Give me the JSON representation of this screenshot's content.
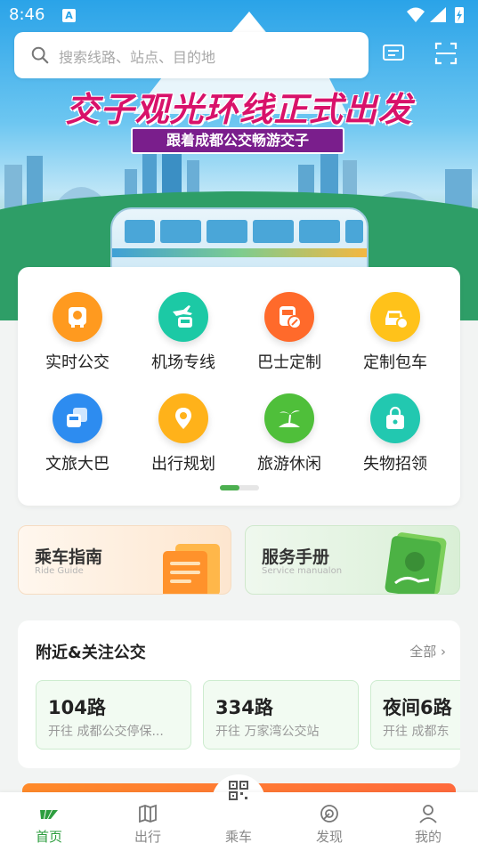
{
  "status_bar": {
    "time": "8:46",
    "notification_icon": "A"
  },
  "search": {
    "placeholder": "搜索线路、站点、目的地"
  },
  "banner": {
    "title": "交子观光环线正式出发",
    "subtitle": "跟着成都公交畅游交子"
  },
  "quick_grid": [
    {
      "label": "实时公交",
      "icon": "realtime-bus-icon",
      "color": "#ff9a1f"
    },
    {
      "label": "机场专线",
      "icon": "airport-bus-icon",
      "color": "#1cc9a5"
    },
    {
      "label": "巴士定制",
      "icon": "custom-bus-icon",
      "color": "#ff6a2b"
    },
    {
      "label": "定制包车",
      "icon": "charter-car-icon",
      "color": "#ffc21a"
    },
    {
      "label": "文旅大巴",
      "icon": "tour-coach-icon",
      "color": "#2d8cf0"
    },
    {
      "label": "出行规划",
      "icon": "location-pin-icon",
      "color": "#ffb21a"
    },
    {
      "label": "旅游休闲",
      "icon": "palm-tree-icon",
      "color": "#4fbf3a"
    },
    {
      "label": "失物招领",
      "icon": "lost-found-bag-icon",
      "color": "#22c8b0"
    }
  ],
  "guides": {
    "ride": {
      "title": "乘车指南",
      "subtitle": "Ride Guide"
    },
    "service": {
      "title": "服务手册",
      "subtitle": "Service manualon"
    }
  },
  "nearby": {
    "heading": "附近&关注公交",
    "more": "全部",
    "routes": [
      {
        "name": "104路",
        "dest": "开往 成都公交停保..."
      },
      {
        "name": "334路",
        "dest": "开往 万家湾公交站"
      },
      {
        "name": "夜间6路",
        "dest": "开往 成都东"
      }
    ]
  },
  "tabs": [
    {
      "label": "首页",
      "icon": "home-logo-icon"
    },
    {
      "label": "出行",
      "icon": "map-icon"
    },
    {
      "label": "乘车",
      "icon": "bus-qr-icon"
    },
    {
      "label": "发现",
      "icon": "discover-icon"
    },
    {
      "label": "我的",
      "icon": "profile-icon"
    }
  ],
  "colors": {
    "accent": "#2e9e3f",
    "banner_title": "#d8126a",
    "banner_sub_bg": "#7a1e8c"
  }
}
